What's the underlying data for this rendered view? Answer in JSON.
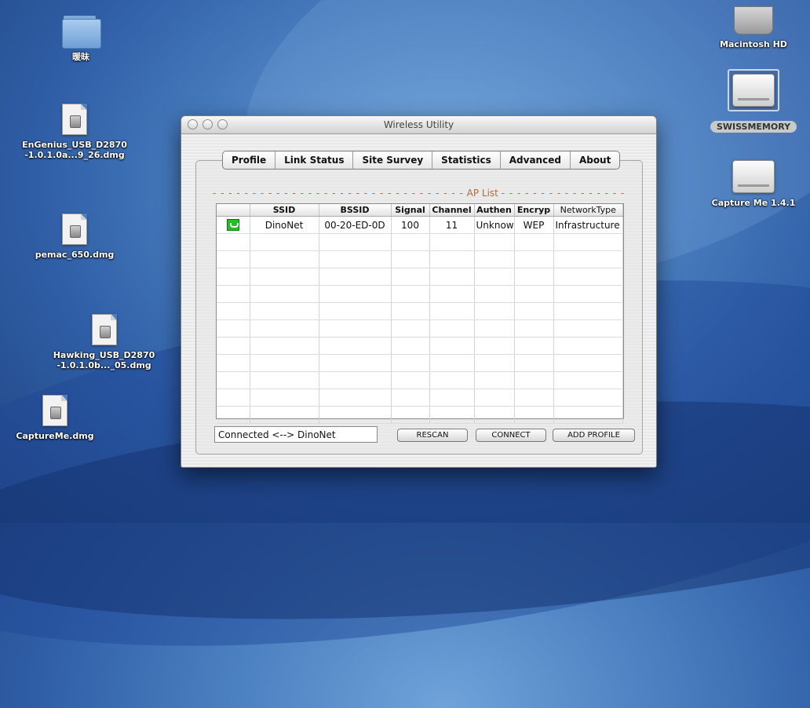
{
  "desktop": {
    "icons": [
      {
        "label": "暖昧"
      },
      {
        "label": "EnGenius_USB_D2870\n-1.0.1.0a...9_26.dmg"
      },
      {
        "label": "pemac_650.dmg"
      },
      {
        "label": "Hawking_USB_D2870\n-1.0.1.0b..._05.dmg"
      },
      {
        "label": "CaptureMe.dmg"
      },
      {
        "label": "Macintosh HD"
      },
      {
        "label": "SWISSMEMORY"
      },
      {
        "label": "Capture Me 1.4.1"
      }
    ]
  },
  "window": {
    "title": "Wireless Utility",
    "tabs": [
      "Profile",
      "Link Status",
      "Site Survey",
      "Statistics",
      "Advanced",
      "About"
    ],
    "ap_list_title": "AP List",
    "table": {
      "columns": [
        "",
        "SSID",
        "BSSID",
        "Signal",
        "Channel",
        "Authen",
        "Encryp",
        "NetworkType"
      ],
      "rows": [
        {
          "icon": "wifi-connected-icon",
          "ssid": "DinoNet",
          "bssid": "00-20-ED-0D",
          "signal": "100",
          "channel": "11",
          "authen": "Unknow",
          "encryp": "WEP",
          "network_type": "Infrastructure"
        }
      ],
      "empty_rows": 11
    },
    "status_text": "Connected <--> DinoNet",
    "buttons": {
      "rescan": "RESCAN",
      "connect": "CONNECT",
      "add_profile": "ADD PROFILE"
    }
  }
}
